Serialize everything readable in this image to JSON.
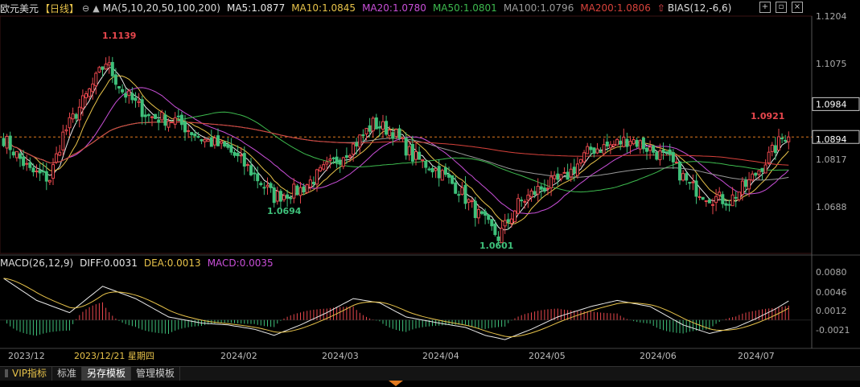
{
  "header": {
    "symbol": "欧元美元",
    "period": "【日线】",
    "lock_icon": "⊖",
    "ma_icon": "▲",
    "ma_params": "MA(5,10,20,50,100,200)",
    "ma5": "MA5:1.0877",
    "ma10": "MA10:1.0845",
    "ma20": "MA20:1.0780",
    "ma50": "MA50:1.0801",
    "ma100": "MA100:1.0796",
    "ma200": "MA200:1.0806",
    "bias": "BIAS(12,-6,6)"
  },
  "macd_header": {
    "params": "MACD(26,12,9)",
    "diff": "DIFF:0.0031",
    "dea": "DEA:0.0013",
    "macd": "MACD:0.0035"
  },
  "price_axis": [
    "1.1204",
    "1.1075",
    "1.0984",
    "1.0894",
    "1.0817",
    "1.0688"
  ],
  "macd_axis": [
    "0.0080",
    "0.0046",
    "0.0012",
    "-0.0021"
  ],
  "x_axis": [
    "2023/12",
    "2023/12/21 星期四",
    "2024/02",
    "2024/03",
    "2024/04",
    "2024/05",
    "2024/06",
    "2024/07"
  ],
  "annotations": {
    "high": "1.1139",
    "low1": "1.0694",
    "low2": "1.0601",
    "recent": "1.0921"
  },
  "tabs": [
    "VIP指标",
    "标准",
    "另存模板",
    "管理模板"
  ],
  "colors": {
    "up": "#e8474d",
    "down": "#3ec07a",
    "ma5": "#e8e8e8",
    "ma10": "#e8c34a",
    "ma20": "#c94fd8",
    "ma50": "#3dba4e",
    "ma100": "#9a9a9a",
    "ma200": "#d8423b",
    "diff": "#e8e8e8",
    "dea": "#e8c34a"
  },
  "chart_data": {
    "type": "candlestick",
    "title": "欧元美元 【日线】",
    "ylim": [
      1.0575,
      1.1225
    ],
    "macd_ylim": [
      -0.0045,
      0.0085
    ],
    "x_labels": [
      "2023/12",
      "2024/02",
      "2024/03",
      "2024/04",
      "2024/05",
      "2024/06",
      "2024/07"
    ],
    "highlights": {
      "high": 1.1139,
      "low1": 1.0694,
      "low2": 1.0601,
      "recent": 1.0921,
      "last_close": 1.0894,
      "reference": 1.0984
    },
    "waypoints": [
      [
        0,
        1.089
      ],
      [
        8,
        1.08
      ],
      [
        14,
        1.078
      ],
      [
        18,
        1.09
      ],
      [
        26,
        1.102
      ],
      [
        31,
        1.11
      ],
      [
        36,
        1.102
      ],
      [
        44,
        1.095
      ],
      [
        52,
        1.094
      ],
      [
        60,
        1.089
      ],
      [
        68,
        1.086
      ],
      [
        74,
        1.081
      ],
      [
        82,
        1.073
      ],
      [
        90,
        1.075
      ],
      [
        98,
        1.081
      ],
      [
        106,
        1.087
      ],
      [
        112,
        1.093
      ],
      [
        118,
        1.091
      ],
      [
        124,
        1.084
      ],
      [
        132,
        1.08
      ],
      [
        138,
        1.075
      ],
      [
        144,
        1.068
      ],
      [
        150,
        1.062
      ],
      [
        156,
        1.071
      ],
      [
        162,
        1.075
      ],
      [
        170,
        1.078
      ],
      [
        178,
        1.086
      ],
      [
        184,
        1.087
      ],
      [
        190,
        1.089
      ],
      [
        196,
        1.086
      ],
      [
        202,
        1.083
      ],
      [
        208,
        1.076
      ],
      [
        214,
        1.073
      ],
      [
        220,
        1.072
      ],
      [
        226,
        1.077
      ],
      [
        232,
        1.084
      ],
      [
        236,
        1.089
      ],
      [
        238,
        1.0905
      ]
    ],
    "macd_waypoints": [
      [
        0,
        0.0068
      ],
      [
        10,
        0.0032
      ],
      [
        20,
        0.0012
      ],
      [
        30,
        0.0055
      ],
      [
        40,
        0.0035
      ],
      [
        50,
        0.0005
      ],
      [
        60,
        -0.0005
      ],
      [
        68,
        -0.0008
      ],
      [
        76,
        -0.0015
      ],
      [
        82,
        -0.0025
      ],
      [
        90,
        -0.0008
      ],
      [
        98,
        0.0012
      ],
      [
        106,
        0.0035
      ],
      [
        114,
        0.0028
      ],
      [
        122,
        0.0005
      ],
      [
        132,
        -0.0005
      ],
      [
        140,
        -0.0012
      ],
      [
        146,
        -0.0025
      ],
      [
        152,
        -0.0032
      ],
      [
        160,
        -0.0015
      ],
      [
        168,
        0.0005
      ],
      [
        178,
        0.0022
      ],
      [
        186,
        0.0032
      ],
      [
        196,
        0.0022
      ],
      [
        206,
        -0.0008
      ],
      [
        214,
        -0.0022
      ],
      [
        222,
        -0.0012
      ],
      [
        228,
        0.0002
      ],
      [
        234,
        0.0018
      ],
      [
        238,
        0.0031
      ]
    ],
    "macd_signal": {
      "diff": 0.0031,
      "dea": 0.0013,
      "macd": 0.0035
    },
    "moving_averages": {
      "MA5": 1.0877,
      "MA10": 1.0845,
      "MA20": 1.078,
      "MA50": 1.0801,
      "MA100": 1.0796,
      "MA200": 1.0806
    }
  }
}
